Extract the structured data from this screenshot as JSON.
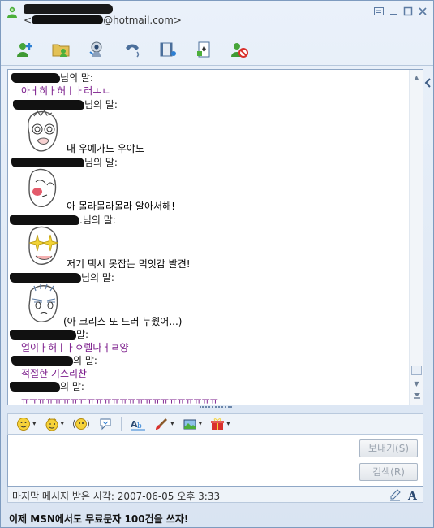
{
  "window": {
    "email_suffix": "@hotmail.com>",
    "email_prefix": "<",
    "controls": [
      "minimize",
      "restore",
      "close"
    ]
  },
  "toolbar": {
    "buttons": [
      {
        "name": "invite-contact",
        "icon": "add-person-icon"
      },
      {
        "name": "send-files",
        "icon": "folder-icon"
      },
      {
        "name": "video-call",
        "icon": "webcam-icon"
      },
      {
        "name": "voice-call",
        "icon": "phone-icon"
      },
      {
        "name": "activities",
        "icon": "film-icon"
      },
      {
        "name": "games",
        "icon": "game-card-icon"
      },
      {
        "name": "block",
        "icon": "block-contact-icon"
      }
    ]
  },
  "conversation": {
    "said_suffix": "님의 말:",
    "lines": [
      {
        "kind": "sender",
        "text": "님의 말:"
      },
      {
        "kind": "message",
        "text": "아ㅓ히ㅏ허ㅣㅏ러ㅗㄴ"
      },
      {
        "kind": "sender",
        "text": "님의 말:"
      },
      {
        "kind": "message",
        "text": "내 우예가노 우야노"
      },
      {
        "kind": "sender",
        "text": "님의 말:"
      },
      {
        "kind": "message",
        "text": "아 몰라몰라몰라 알아서해!"
      },
      {
        "kind": "sender",
        "text": ".님의 말:"
      },
      {
        "kind": "message",
        "text": "저기 택시 못잡는 먹잇감 발견!"
      },
      {
        "kind": "sender",
        "text": "님의 말:"
      },
      {
        "kind": "message",
        "text": "(아 크리스 또 드러 누웠어...)"
      },
      {
        "kind": "sender",
        "text": "말:"
      },
      {
        "kind": "message",
        "text": "얼이ㅏ허ㅣㅏㅇ렐나ㅓㄹ양"
      },
      {
        "kind": "sender",
        "text": "의 말:"
      },
      {
        "kind": "message",
        "text": "적절한 기스리찬"
      },
      {
        "kind": "sender",
        "text": "의 말:"
      },
      {
        "kind": "message",
        "text": "ㅠㅠㅠㅠㅠㅠㅠㅠㅠㅠㅠㅠㅠㅠㅠㅠㅠㅠㅠㅠㅠㅠㅠㅠ"
      }
    ]
  },
  "emoticon_bar": {
    "buttons": [
      "smiley-icon",
      "wink-icon",
      "nudge-icon",
      "voice-clip-icon",
      "font-icon",
      "brush-icon",
      "background-icon",
      "gift-icon"
    ]
  },
  "compose": {
    "placeholder": "",
    "send_label": "보내기(S)",
    "search_label": "검색(R)"
  },
  "status": {
    "last_message": "마지막 메시지 받은 시각: 2007-06-05 오후 3:33"
  },
  "ad": {
    "text": "이제 MSN에서도 무료문자 100건을 쓰자!"
  }
}
